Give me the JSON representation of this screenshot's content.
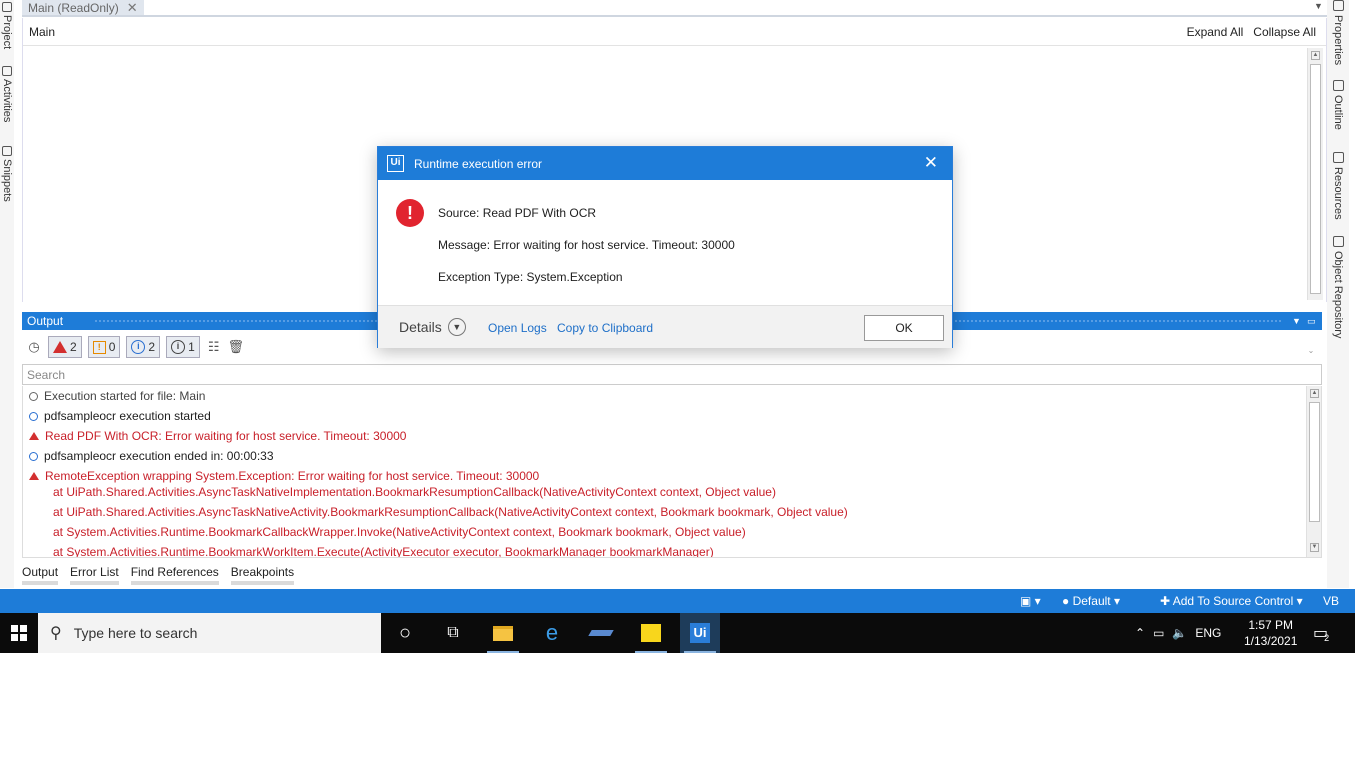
{
  "left_rail": {
    "tabs": [
      "Project",
      "Activities",
      "Snippets"
    ]
  },
  "right_rail": {
    "tabs": [
      "Properties",
      "Outline",
      "Resources",
      "Object Repository"
    ]
  },
  "doc_tab": {
    "label": "Main (ReadOnly)",
    "close": "✕"
  },
  "designer": {
    "breadcrumb": "Main",
    "expand_all": "Expand All",
    "collapse_all": "Collapse All"
  },
  "output": {
    "title": "Output",
    "filters": {
      "errors": "2",
      "warnings": "0",
      "info": "2",
      "trace": "1"
    },
    "search_placeholder": "Search",
    "lines": [
      {
        "level": "trace",
        "text": "Execution started for file: Main"
      },
      {
        "level": "info",
        "text": "pdfsampleocr execution started"
      },
      {
        "level": "error",
        "text": "Read PDF With OCR: Error waiting for host service. Timeout: 30000"
      },
      {
        "level": "info",
        "text": "pdfsampleocr execution ended in: 00:00:33"
      },
      {
        "level": "error",
        "text": "RemoteException wrapping System.Exception: Error waiting for host service. Timeout: 30000"
      },
      {
        "level": "stack",
        "text": "at UiPath.Shared.Activities.AsyncTaskNativeImplementation.BookmarkResumptionCallback(NativeActivityContext context, Object value)"
      },
      {
        "level": "stack",
        "text": "at UiPath.Shared.Activities.AsyncTaskNativeActivity.BookmarkResumptionCallback(NativeActivityContext context, Bookmark bookmark, Object value)"
      },
      {
        "level": "stack",
        "text": "at System.Activities.Runtime.BookmarkCallbackWrapper.Invoke(NativeActivityContext context, Bookmark bookmark, Object value)"
      },
      {
        "level": "stack",
        "text": "at System.Activities.Runtime.BookmarkWorkItem.Execute(ActivityExecutor executor, BookmarkManager bookmarkManager)"
      }
    ]
  },
  "bottom_tabs": [
    "Output",
    "Error List",
    "Find References",
    "Breakpoints"
  ],
  "status_bar": {
    "profile": "Default",
    "source_control": "Add To Source Control",
    "language": "VB"
  },
  "taskbar": {
    "search_placeholder": "Type here to search",
    "language": "ENG",
    "time": "1:57 PM",
    "date": "1/13/2021",
    "notifications": "2"
  },
  "dialog": {
    "logo": "Ui",
    "title": "Runtime execution error",
    "source": "Source: Read PDF With OCR",
    "message": "Message: Error waiting for host service. Timeout: 30000",
    "exception": "Exception Type: System.Exception",
    "details": "Details",
    "open_logs": "Open Logs",
    "copy": "Copy to Clipboard",
    "ok": "OK"
  },
  "colors": {
    "accent": "#1e7cd8",
    "error": "#c8202a",
    "link": "#1e6fc8"
  }
}
